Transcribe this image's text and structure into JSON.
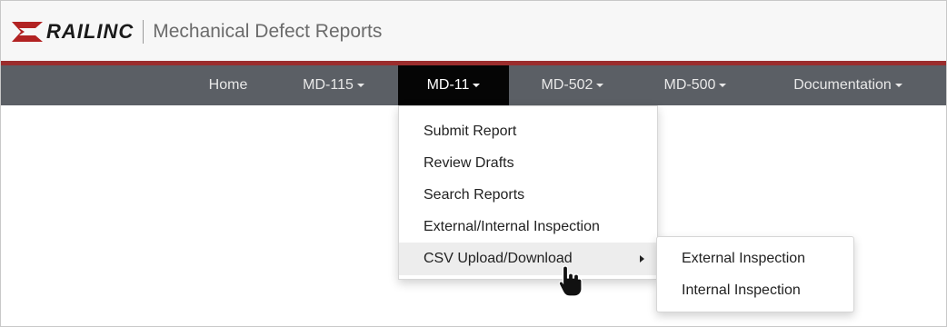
{
  "header": {
    "brand": "RAILINC",
    "app_title": "Mechanical Defect Reports"
  },
  "nav": {
    "items": [
      {
        "label": "Home",
        "has_caret": false
      },
      {
        "label": "MD-115",
        "has_caret": true
      },
      {
        "label": "MD-11",
        "has_caret": true,
        "active": true
      },
      {
        "label": "MD-502",
        "has_caret": true
      },
      {
        "label": "MD-500",
        "has_caret": true
      },
      {
        "label": "Documentation",
        "has_caret": true
      }
    ]
  },
  "md11_menu": {
    "items": [
      {
        "label": "Submit Report"
      },
      {
        "label": "Review Drafts"
      },
      {
        "label": "Search Reports"
      },
      {
        "label": "External/Internal Inspection"
      },
      {
        "label": "CSV Upload/Download",
        "has_submenu": true,
        "hovered": true
      }
    ]
  },
  "csv_submenu": {
    "items": [
      {
        "label": "External Inspection"
      },
      {
        "label": "Internal Inspection"
      }
    ]
  },
  "colors": {
    "nav_bg": "#5b5f65",
    "nav_active_bg": "#050505",
    "accent_red": "#9b2d2d",
    "header_bg": "#f7f7f7"
  },
  "icons": {
    "logo": "railinc-chevron-logo",
    "cursor": "hand-pointer-icon"
  }
}
